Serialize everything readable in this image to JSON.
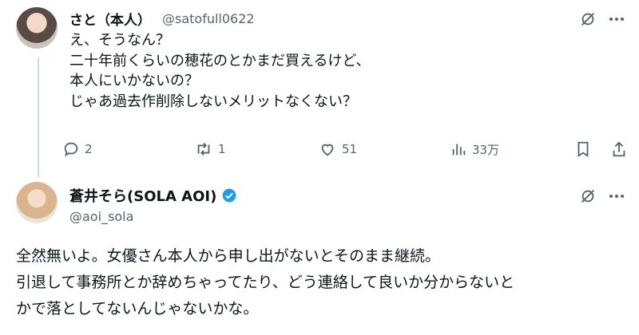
{
  "tweet1": {
    "display_name": "さと（本人）",
    "handle": "@satofull0622",
    "lines": [
      "え、そうなん？",
      "二十年前くらいの穂花のとかまだ買えるけど、",
      "本人にいかないの？",
      "じゃあ過去作削除しないメリットなくない？"
    ],
    "replies": "2",
    "reposts": "1",
    "likes": "51",
    "views": "33万"
  },
  "tweet2": {
    "display_name": "蒼井そら(SOLA AOI)",
    "handle": "@aoi_sola",
    "verified_color": "#1d9bf0",
    "lines": [
      "全然無いよ。女優さん本人から申し出がないとそのまま継続。",
      "引退して事務所とか辞めちゃってたり、どう連絡して良いか分からないと",
      "かで落としてないんじゃないかな。"
    ]
  }
}
